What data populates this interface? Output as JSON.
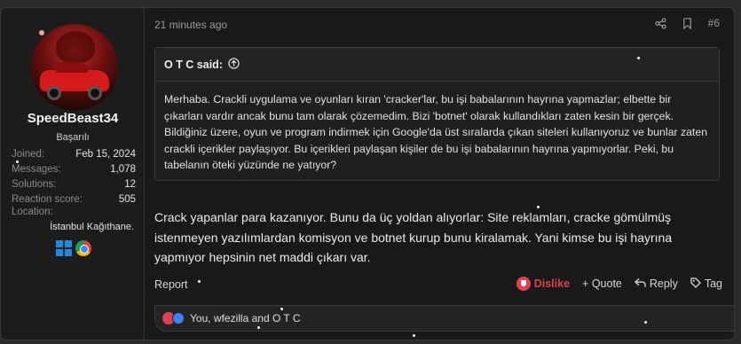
{
  "user": {
    "name": "SpeedBeast34",
    "title": "Başarılı",
    "stats": [
      {
        "label": "Joined:",
        "value": "Feb 15, 2024"
      },
      {
        "label": "Messages:",
        "value": "1,078"
      },
      {
        "label": "Solutions:",
        "value": "12"
      },
      {
        "label": "Reaction score:",
        "value": "505"
      }
    ],
    "location_label": "Location:",
    "location_value": "İstanbul Kağıthane.",
    "os_icons": [
      "windows-icon",
      "chrome-icon"
    ]
  },
  "post": {
    "timestamp": "21 minutes ago",
    "number": "#6",
    "quote": {
      "author": "O T C said:",
      "text": "Merhaba. Crackli uygulama ve oyunları kıran 'cracker'lar, bu işi babalarının hayrına yapmazlar; elbette bir çıkarları vardır ancak bunu tam olarak çözemedim. Bizi 'botnet' olarak kullandıkları zaten kesin bir gerçek. Bildiğiniz üzere, oyun ve program indirmek için Google'da üst sıralarda çıkan siteleri kullanıyoruz ve bunlar zaten crackli içerikler paylaşıyor. Bu içerikleri paylaşan kişiler de bu işi babalarının hayrına yapmıyorlar. Peki, bu tabelanın öteki yüzünde ne yatıyor?"
    },
    "message": "Crack yapanlar para kazanıyor. Bunu da üç yoldan alıyorlar: Site reklamları, cracke gömülmüş istenmeyen yazılımlardan komisyon ve botnet kurup bunu kiralamak. Yani kimse bu işi hayrına yapmıyor hepsinin net maddi çıkarı var.",
    "footer": {
      "report": "Report",
      "dislike": "Dislike",
      "quote": "+ Quote",
      "reply": "Reply",
      "tag": "Tag"
    },
    "reactions_text": "You, wfezilla and O T C"
  },
  "colors": {
    "background": "#19191a",
    "dislike": "#e0414f",
    "accent_blue": "#3b82f6"
  }
}
